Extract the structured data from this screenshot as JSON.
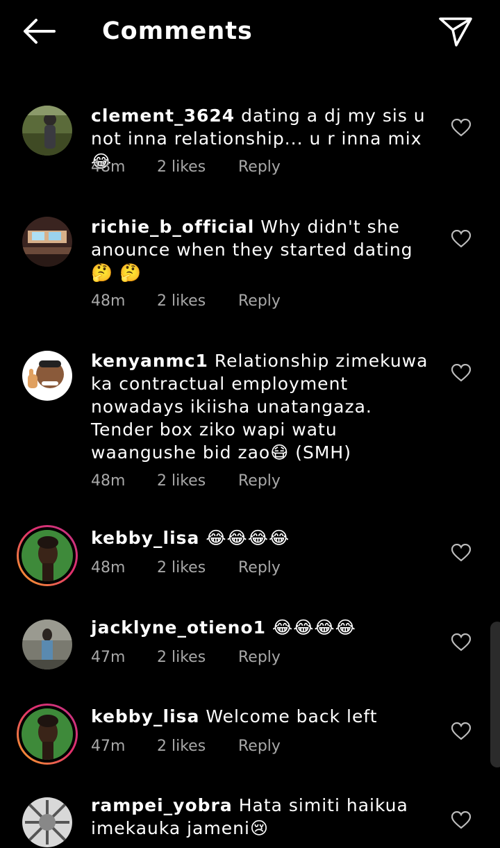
{
  "header": {
    "title": "Comments",
    "back_icon": "arrow-left-icon",
    "share_icon": "paper-plane-icon"
  },
  "comments": [
    {
      "username": "clement_3624",
      "text": "dating a dj my sis u not inna relationship... u r inna mix😂",
      "time": "48m",
      "likes": "2 likes",
      "reply": "Reply"
    },
    {
      "username": "richie_b_official",
      "text": "Why didn't she anounce when they started dating 🤔 🤔",
      "time": "48m",
      "likes": "2 likes",
      "reply": "Reply"
    },
    {
      "username": "kenyanmc1",
      "text": "Relationship zimekuwa ka contractual employment nowadays ikiisha unatangaza. Tender box ziko wapi watu waangushe bid zao😷 (SMH)",
      "time": "48m",
      "likes": "2 likes",
      "reply": "Reply"
    },
    {
      "username": "kebby_lisa",
      "text": "😂😂😂😂",
      "time": "48m",
      "likes": "2 likes",
      "reply": "Reply"
    },
    {
      "username": "jacklyne_otieno1",
      "text": "😂😂😂😂",
      "time": "47m",
      "likes": "2 likes",
      "reply": "Reply"
    },
    {
      "username": "kebby_lisa",
      "text": "Welcome back left",
      "time": "47m",
      "likes": "2 likes",
      "reply": "Reply"
    },
    {
      "username": "rampei_yobra",
      "text": "Hata simiti haikua imekauka jameni😢",
      "time": "",
      "likes": "",
      "reply": ""
    }
  ],
  "colors": {
    "background": "#000000",
    "text": "#ffffff",
    "meta": "#a8a8a8",
    "story_ring_start": "#f9a825",
    "story_ring_end": "#c13584"
  }
}
